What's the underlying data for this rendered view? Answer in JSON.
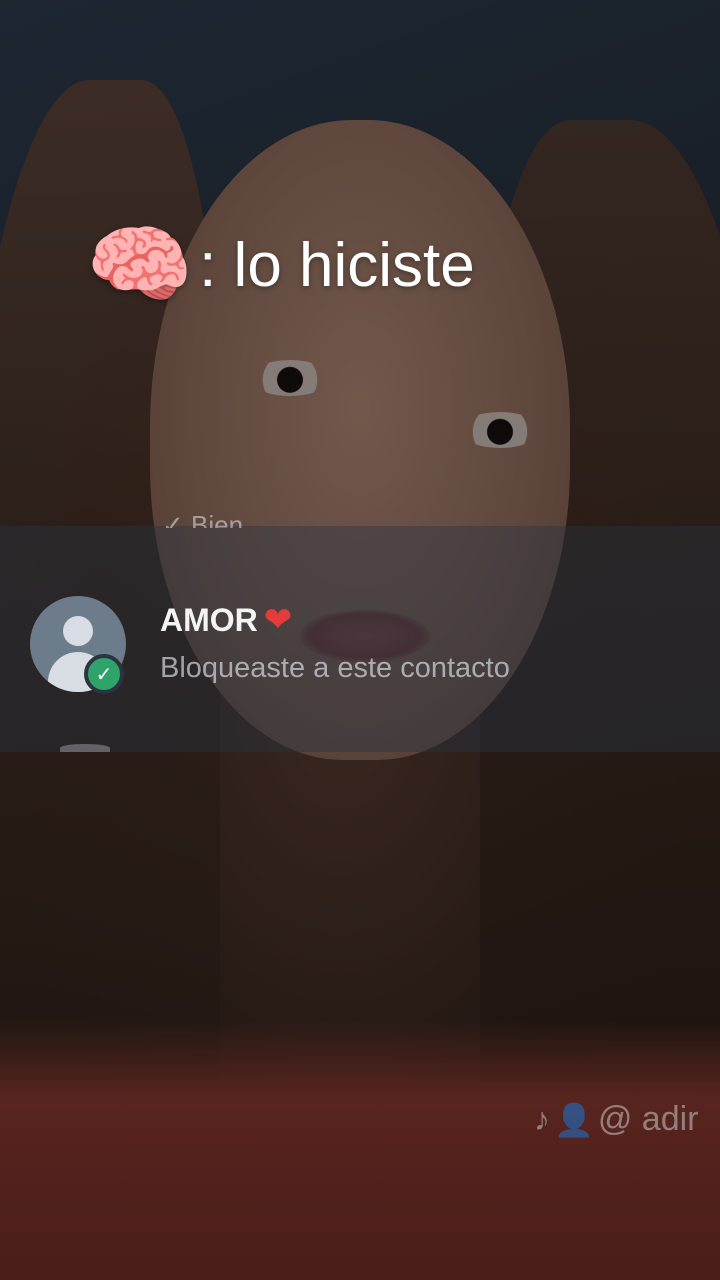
{
  "caption": {
    "emoji": "🧠",
    "text": ": lo hiciste"
  },
  "chat_list": {
    "previous_row_partial": "✓ Bien",
    "row": {
      "name": "AMOR",
      "name_emoji": "❤",
      "message": "Bloqueaste a este contacto",
      "avatar": "default-contact-icon",
      "badge": "check-icon"
    }
  },
  "watermark": {
    "logo": "tiktok-icon",
    "user_icon": "person-icon",
    "handle": "@ adir"
  },
  "colors": {
    "badge_green": "#2ea36a",
    "heart_red": "#e53b3b"
  }
}
